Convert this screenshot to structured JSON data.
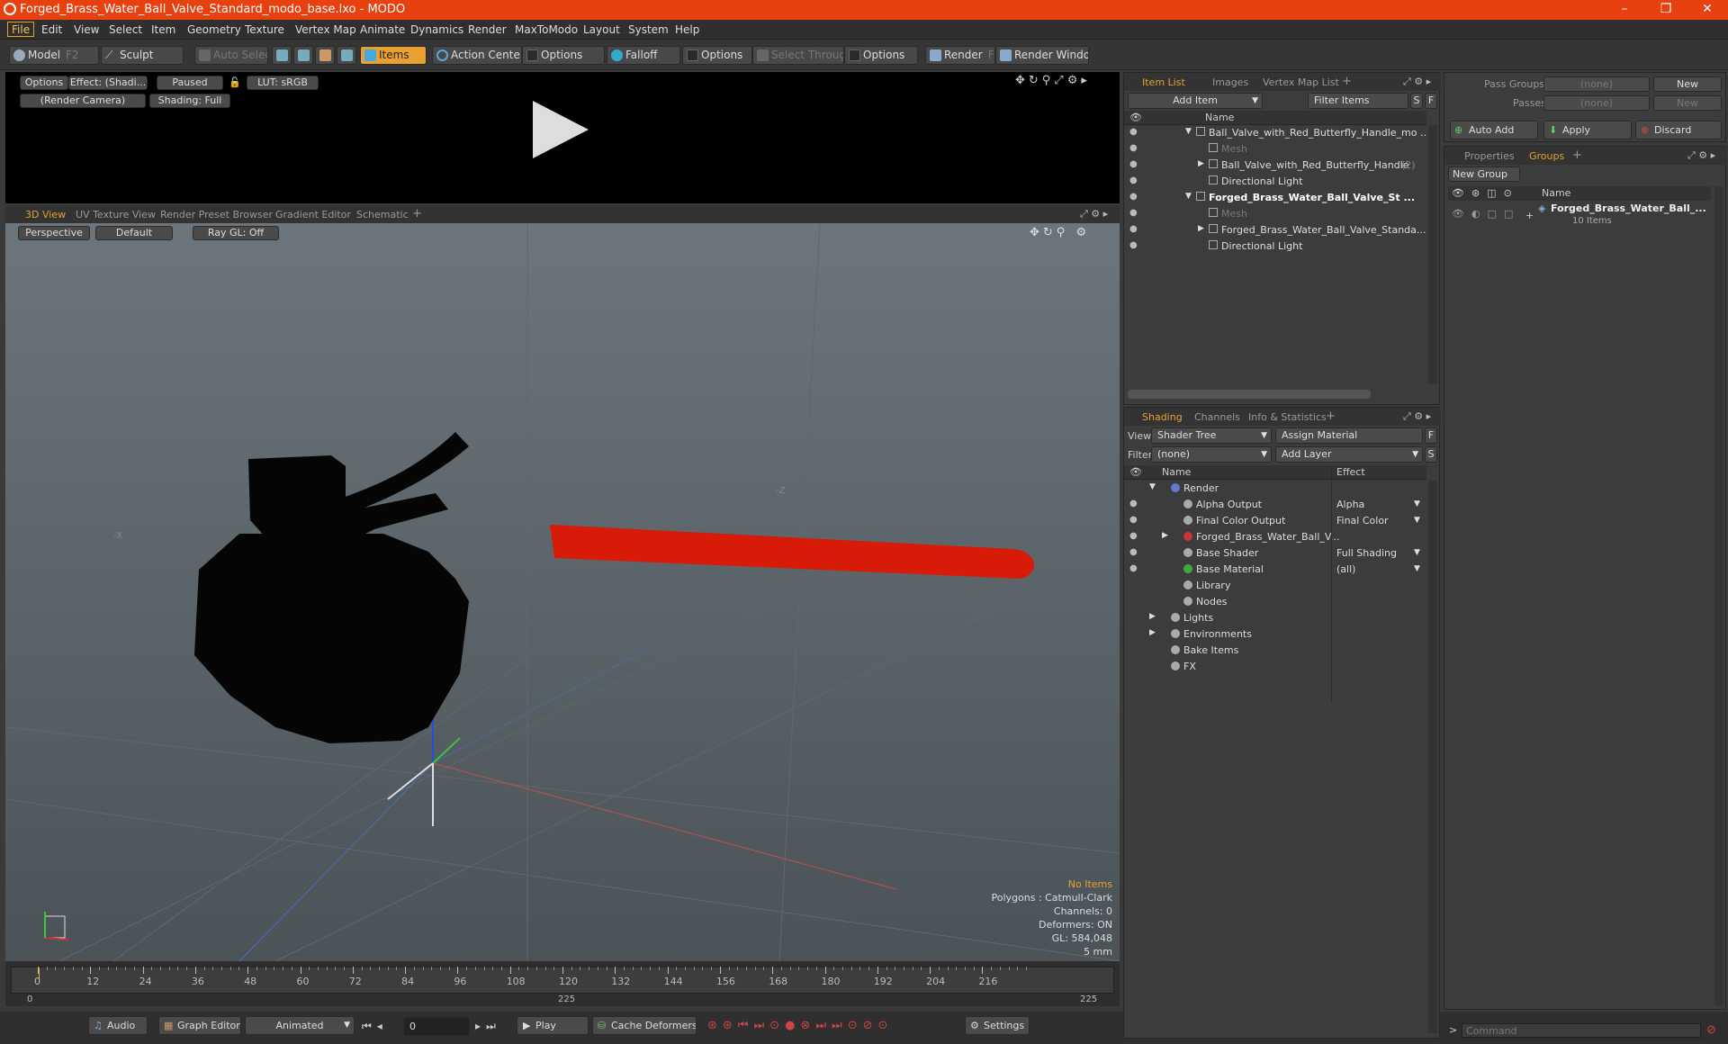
{
  "window": {
    "title": "Forged_Brass_Water_Ball_Valve_Standard_modo_base.lxo - MODO",
    "minimize": "–",
    "restore": "❐",
    "close": "✕"
  },
  "menu": [
    "File",
    "Edit",
    "View",
    "Select",
    "Item",
    "Geometry",
    "Texture",
    "Vertex Map",
    "Animate",
    "Dynamics",
    "Render",
    "MaxToModo",
    "Layout",
    "System",
    "Help"
  ],
  "toolbar": {
    "model": "Model",
    "model_key": "F2",
    "sculpt": "Sculpt",
    "auto_select": "Auto Select",
    "items": "Items",
    "action_center": "Action Center",
    "options1": "Options",
    "falloff": "Falloff",
    "options2": "Options",
    "select_through": "Select Through",
    "options3": "Options",
    "render": "Render",
    "render_key": "F9",
    "render_window": "Render Window"
  },
  "render_view": {
    "options": "Options",
    "effect": "Effect: (Shadi...",
    "paused": "Paused",
    "lut": "LUT: sRGB",
    "camera": "(Render Camera)",
    "shading": "Shading: Full"
  },
  "view_tabs": [
    "3D View",
    "UV Texture View",
    "Render Preset Browser",
    "Gradient Editor",
    "Schematic"
  ],
  "viewport": {
    "perspective": "Perspective",
    "default": "Default",
    "raygl": "Ray GL: Off",
    "axis_x": "-X",
    "axis_z": "-Z",
    "info": {
      "items": "No Items",
      "polygons": "Polygons : Catmull-Clark",
      "channels": "Channels: 0",
      "deformers": "Deformers: ON",
      "gl": "GL: 584,048",
      "scale": "5 mm"
    }
  },
  "timeline": {
    "ticks": [
      "0",
      "12",
      "24",
      "36",
      "48",
      "60",
      "72",
      "84",
      "96",
      "108",
      "120",
      "132",
      "144",
      "156",
      "168",
      "180",
      "192",
      "204",
      "216"
    ],
    "start": "0",
    "mid": "225",
    "end": "225"
  },
  "bottombar": {
    "audio": "Audio",
    "graph_editor": "Graph Editor",
    "animated": "Animated",
    "frame": "0",
    "play": "Play",
    "cache": "Cache Deformers",
    "settings": "Settings"
  },
  "item_list": {
    "tabs": [
      "Item List",
      "Images",
      "Vertex Map List"
    ],
    "add_item": "Add Item",
    "filter_items": "Filter Items",
    "s": "S",
    "f": "F",
    "col_name": "Name",
    "rows": [
      {
        "label": "Ball_Valve_with_Red_Butterfly_Handle_mo ...",
        "indent": 0,
        "expand": "▼",
        "bold": false,
        "dim": false
      },
      {
        "label": "Mesh",
        "indent": 1,
        "expand": "",
        "bold": false,
        "dim": true
      },
      {
        "label": "Ball_Valve_with_Red_Butterfly_Handle",
        "suffix": "(2)",
        "indent": 1,
        "expand": "▶",
        "bold": false,
        "dim": false
      },
      {
        "label": "Directional Light",
        "indent": 1,
        "expand": "",
        "bold": false,
        "dim": false
      },
      {
        "label": "Forged_Brass_Water_Ball_Valve_St ...",
        "indent": 0,
        "expand": "▼",
        "bold": true,
        "dim": false
      },
      {
        "label": "Mesh",
        "indent": 1,
        "expand": "",
        "bold": false,
        "dim": true
      },
      {
        "label": "Forged_Brass_Water_Ball_Valve_Standa...",
        "indent": 1,
        "expand": "▶",
        "bold": false,
        "dim": false
      },
      {
        "label": "Directional Light",
        "indent": 1,
        "expand": "",
        "bold": false,
        "dim": false
      }
    ]
  },
  "shading": {
    "tabs": [
      "Shading",
      "Channels",
      "Info & Statistics"
    ],
    "view_label": "View",
    "view_value": "Shader Tree",
    "assign_material": "Assign Material",
    "f": "F",
    "filter_label": "Filter",
    "filter_value": "(none)",
    "add_layer": "Add Layer",
    "s": "S",
    "col_name": "Name",
    "col_effect": "Effect",
    "rows": [
      {
        "label": "Render",
        "effect": "",
        "indent": 0,
        "expand": "▼",
        "eye": false
      },
      {
        "label": "Alpha Output",
        "effect": "Alpha",
        "indent": 1,
        "expand": "",
        "eye": true
      },
      {
        "label": "Final Color Output",
        "effect": "Final Color",
        "indent": 1,
        "expand": "",
        "eye": true
      },
      {
        "label": "Forged_Brass_Water_Ball_V...",
        "effect": "",
        "indent": 1,
        "expand": "▶",
        "eye": true
      },
      {
        "label": "Base Shader",
        "effect": "Full Shading",
        "indent": 1,
        "expand": "",
        "eye": true
      },
      {
        "label": "Base Material",
        "effect": "(all)",
        "indent": 1,
        "expand": "",
        "eye": true
      },
      {
        "label": "Library",
        "effect": "",
        "indent": 1,
        "expand": "",
        "eye": false
      },
      {
        "label": "Nodes",
        "effect": "",
        "indent": 1,
        "expand": "",
        "eye": false
      },
      {
        "label": "Lights",
        "effect": "",
        "indent": 0,
        "expand": "▶",
        "eye": false
      },
      {
        "label": "Environments",
        "effect": "",
        "indent": 0,
        "expand": "▶",
        "eye": false
      },
      {
        "label": "Bake Items",
        "effect": "",
        "indent": 0,
        "expand": "",
        "eye": false
      },
      {
        "label": "FX",
        "effect": "",
        "indent": 0,
        "expand": "",
        "eye": false
      }
    ]
  },
  "pass_panel": {
    "pass_groups": "Pass Groups",
    "passes": "Passes",
    "none1": "(none)",
    "none2": "(none)",
    "new1": "New",
    "new2": "New",
    "auto_add": "Auto Add",
    "apply": "Apply",
    "discard": "Discard"
  },
  "groups": {
    "tabs": [
      "Properties",
      "Groups"
    ],
    "new_group": "New Group",
    "col_name": "Name",
    "group_name": "Forged_Brass_Water_Ball_...",
    "group_count": "10 Items"
  },
  "command": {
    "placeholder": "Command"
  },
  "colors": {
    "accent": "#e8a030",
    "titlebar": "#e8410f",
    "handle": "#d81a08"
  }
}
